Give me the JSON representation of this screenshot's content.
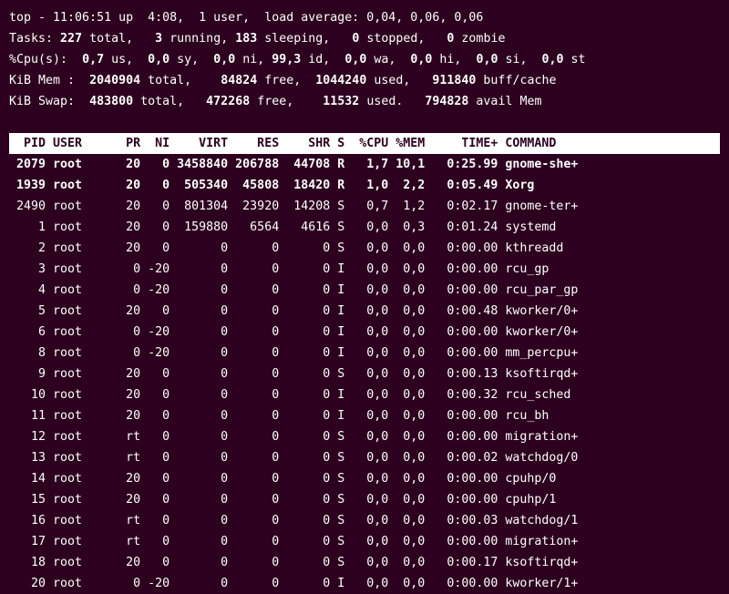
{
  "summary": {
    "line1_a": "top - 11:06:51 up  4:08,  1 user,  load average: 0,04, 0,06, 0,06",
    "line2_a": "Tasks: ",
    "line2_b": "227 ",
    "line2_c": "total,   ",
    "line2_d": "3 ",
    "line2_e": "running, ",
    "line2_f": "183 ",
    "line2_g": "sleeping,   ",
    "line2_h": "0 ",
    "line2_i": "stopped,   ",
    "line2_j": "0 ",
    "line2_k": "zombie",
    "line3_a": "%Cpu(s):  ",
    "line3_b": "0,7 ",
    "line3_c": "us,  ",
    "line3_d": "0,0 ",
    "line3_e": "sy,  ",
    "line3_f": "0,0 ",
    "line3_g": "ni, ",
    "line3_h": "99,3 ",
    "line3_i": "id,  ",
    "line3_j": "0,0 ",
    "line3_k": "wa,  ",
    "line3_l": "0,0 ",
    "line3_m": "hi,  ",
    "line3_n": "0,0 ",
    "line3_o": "si,  ",
    "line3_p": "0,0 ",
    "line3_q": "st",
    "line4_a": "KiB Mem : ",
    "line4_b": " 2040904 ",
    "line4_c": "total,   ",
    "line4_d": " 84824 ",
    "line4_e": "free,  ",
    "line4_f": "1044240 ",
    "line4_g": "used,   ",
    "line4_h": "911840 ",
    "line4_i": "buff/cache",
    "line5_a": "KiB Swap:  ",
    "line5_b": "483800 ",
    "line5_c": "total,   ",
    "line5_d": "472268 ",
    "line5_e": "free,    ",
    "line5_f": "11532 ",
    "line5_g": "used.   ",
    "line5_h": "794828 ",
    "line5_i": "avail Mem"
  },
  "header": "  PID USER      PR  NI    VIRT    RES    SHR S  %CPU %MEM     TIME+ COMMAND   ",
  "rows": [
    {
      "bold": true,
      "text": " 2079 root      20   0 3458840 206788  44708 R   1,7 10,1   0:25.99 gnome-she+"
    },
    {
      "bold": true,
      "text": " 1939 root      20   0  505340  45808  18420 R   1,0  2,2   0:05.49 Xorg      "
    },
    {
      "bold": false,
      "text": " 2490 root      20   0  801304  23920  14208 S   0,7  1,2   0:02.17 gnome-ter+"
    },
    {
      "bold": false,
      "text": "    1 root      20   0  159880   6564   4616 S   0,0  0,3   0:01.24 systemd   "
    },
    {
      "bold": false,
      "text": "    2 root      20   0       0      0      0 S   0,0  0,0   0:00.00 kthreadd  "
    },
    {
      "bold": false,
      "text": "    3 root       0 -20       0      0      0 I   0,0  0,0   0:00.00 rcu_gp    "
    },
    {
      "bold": false,
      "text": "    4 root       0 -20       0      0      0 I   0,0  0,0   0:00.00 rcu_par_gp"
    },
    {
      "bold": false,
      "text": "    5 root      20   0       0      0      0 I   0,0  0,0   0:00.48 kworker/0+"
    },
    {
      "bold": false,
      "text": "    6 root       0 -20       0      0      0 I   0,0  0,0   0:00.00 kworker/0+"
    },
    {
      "bold": false,
      "text": "    8 root       0 -20       0      0      0 I   0,0  0,0   0:00.00 mm_percpu+"
    },
    {
      "bold": false,
      "text": "    9 root      20   0       0      0      0 S   0,0  0,0   0:00.13 ksoftirqd+"
    },
    {
      "bold": false,
      "text": "   10 root      20   0       0      0      0 I   0,0  0,0   0:00.32 rcu_sched "
    },
    {
      "bold": false,
      "text": "   11 root      20   0       0      0      0 I   0,0  0,0   0:00.00 rcu_bh    "
    },
    {
      "bold": false,
      "text": "   12 root      rt   0       0      0      0 S   0,0  0,0   0:00.00 migration+"
    },
    {
      "bold": false,
      "text": "   13 root      rt   0       0      0      0 S   0,0  0,0   0:00.02 watchdog/0"
    },
    {
      "bold": false,
      "text": "   14 root      20   0       0      0      0 S   0,0  0,0   0:00.00 cpuhp/0   "
    },
    {
      "bold": false,
      "text": "   15 root      20   0       0      0      0 S   0,0  0,0   0:00.00 cpuhp/1   "
    },
    {
      "bold": false,
      "text": "   16 root      rt   0       0      0      0 S   0,0  0,0   0:00.03 watchdog/1"
    },
    {
      "bold": false,
      "text": "   17 root      rt   0       0      0      0 S   0,0  0,0   0:00.00 migration+"
    },
    {
      "bold": false,
      "text": "   18 root      20   0       0      0      0 S   0,0  0,0   0:00.17 ksoftirqd+"
    },
    {
      "bold": false,
      "text": "   20 root       0 -20       0      0      0 I   0,0  0,0   0:00.00 kworker/1+"
    }
  ]
}
